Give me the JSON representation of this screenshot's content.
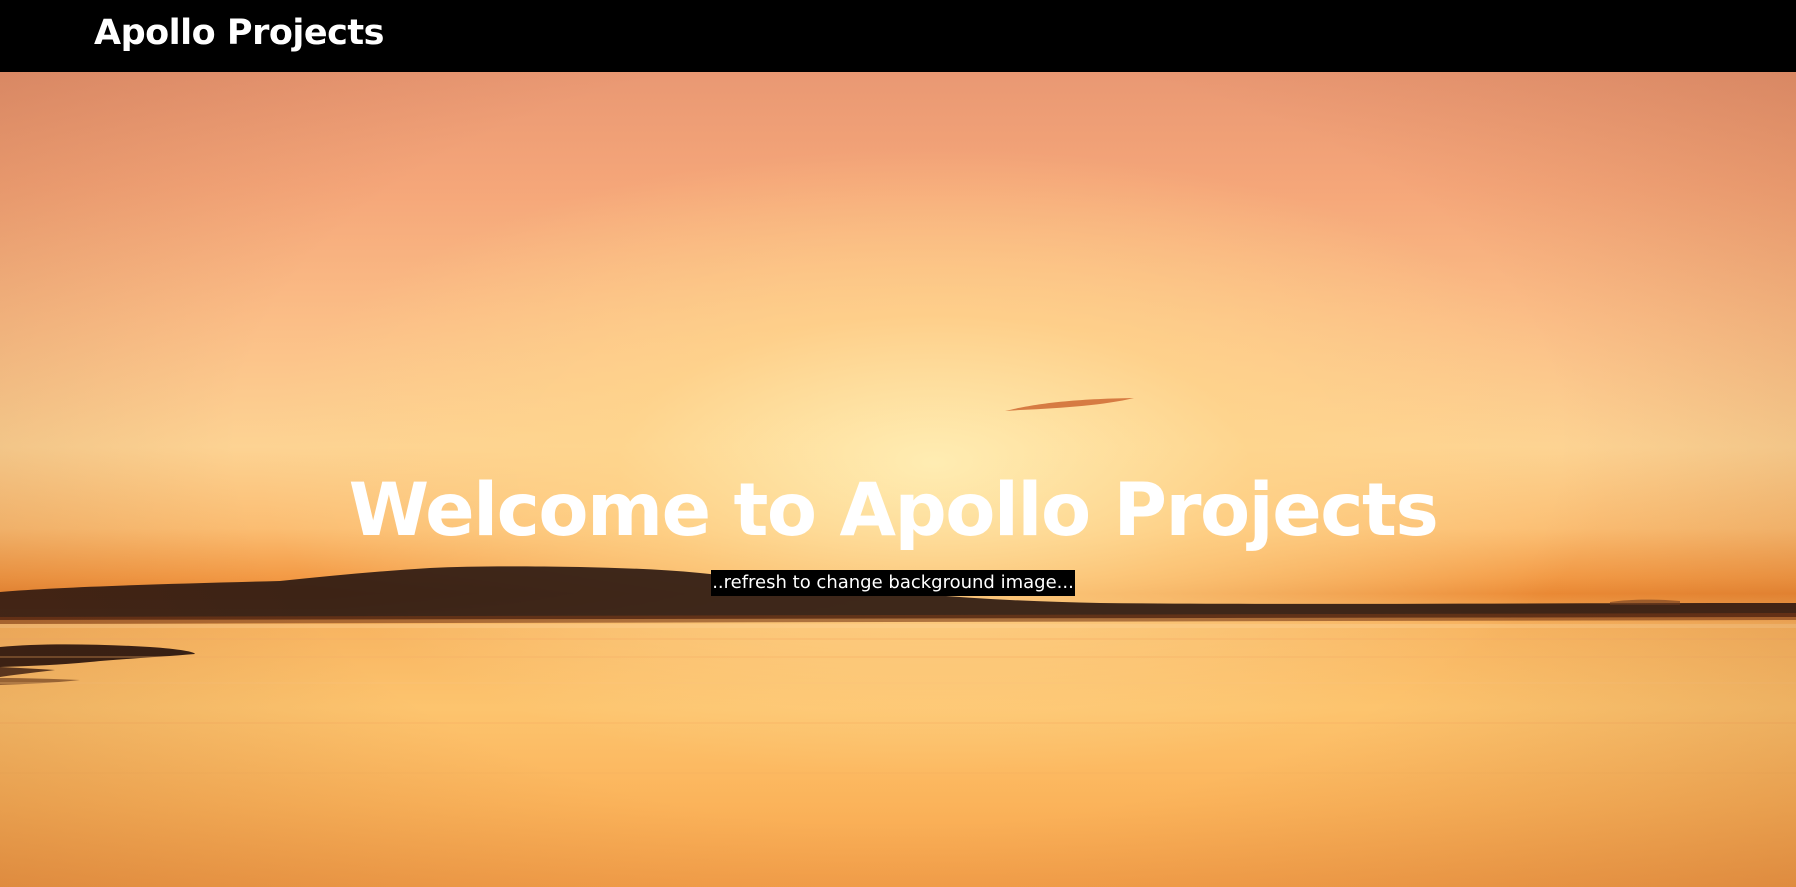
{
  "navbar": {
    "brand": "Apollo Projects"
  },
  "hero": {
    "title": "Welcome to Apollo Projects",
    "subtitle": "..refresh to change background image..."
  },
  "colors": {
    "navbar_background": "#000000",
    "text": "#ffffff",
    "subtitle_background": "#000000"
  }
}
